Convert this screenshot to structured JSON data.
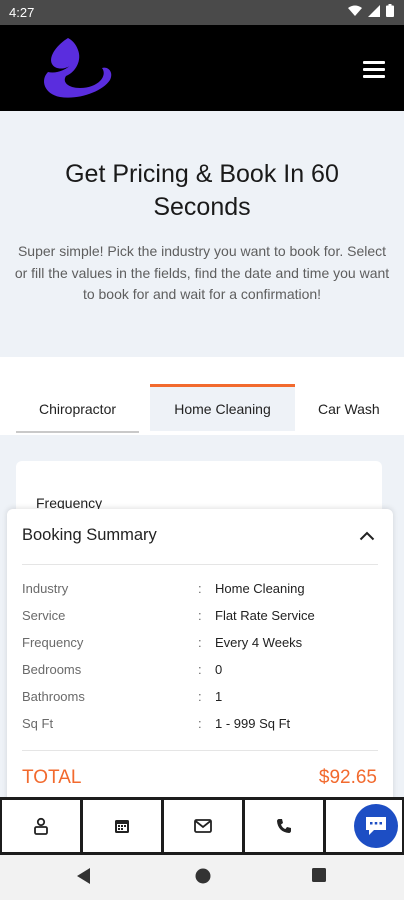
{
  "status_bar": {
    "time": "4:27"
  },
  "header": {
    "logo_icon": "brand-flame-logo",
    "menu_icon": "hamburger-menu-icon",
    "logo_color": "#5a2dde"
  },
  "hero": {
    "title": "Get Pricing & Book In 60 Seconds",
    "description": "Super simple! Pick the industry you want to book for. Select or fill the values in the fields, find the date and time you want to book for and wait for a confirmation!"
  },
  "tabs": [
    {
      "label": "Chiropractor",
      "active": false
    },
    {
      "label": "Home Cleaning",
      "active": true
    },
    {
      "label": "Car Wash",
      "active": false
    }
  ],
  "form": {
    "frequency_label": "Frequency"
  },
  "summary": {
    "title": "Booking Summary",
    "separator": ":",
    "rows": [
      {
        "label": "Industry",
        "value": "Home Cleaning"
      },
      {
        "label": "Service",
        "value": "Flat Rate Service"
      },
      {
        "label": "Frequency",
        "value": "Every 4 Weeks"
      },
      {
        "label": "Bedrooms",
        "value": "0"
      },
      {
        "label": "Bathrooms",
        "value": "1"
      },
      {
        "label": "Sq Ft",
        "value": "1 - 999 Sq Ft"
      }
    ],
    "total_label": "TOTAL",
    "total_value": "$92.65"
  },
  "bottom_nav": {
    "items": [
      "person-icon",
      "calendar-icon",
      "mail-icon",
      "phone-icon"
    ],
    "chat_icon": "chat-bubble-icon"
  },
  "colors": {
    "accent": "#f26a2e",
    "chat": "#1d4ec4",
    "header_bg": "#000000"
  }
}
